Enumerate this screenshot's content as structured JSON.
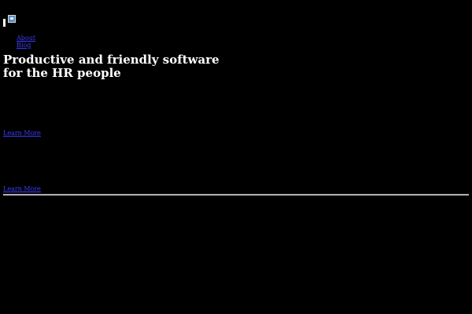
{
  "header": {
    "logo_icon": "broken-image-icon"
  },
  "nav": {
    "items": [
      {
        "label": "About"
      },
      {
        "label": "Blog"
      }
    ]
  },
  "hero": {
    "headline_line1": "Productive and friendly software",
    "headline_line2": "for the HR people"
  },
  "sections": [
    {
      "link_label": "Learn More"
    },
    {
      "link_label": "Learn More"
    }
  ],
  "colors": {
    "background": "#000000",
    "text": "#ffffff",
    "link": "#3d3dff",
    "divider": "#9a9a9a"
  }
}
